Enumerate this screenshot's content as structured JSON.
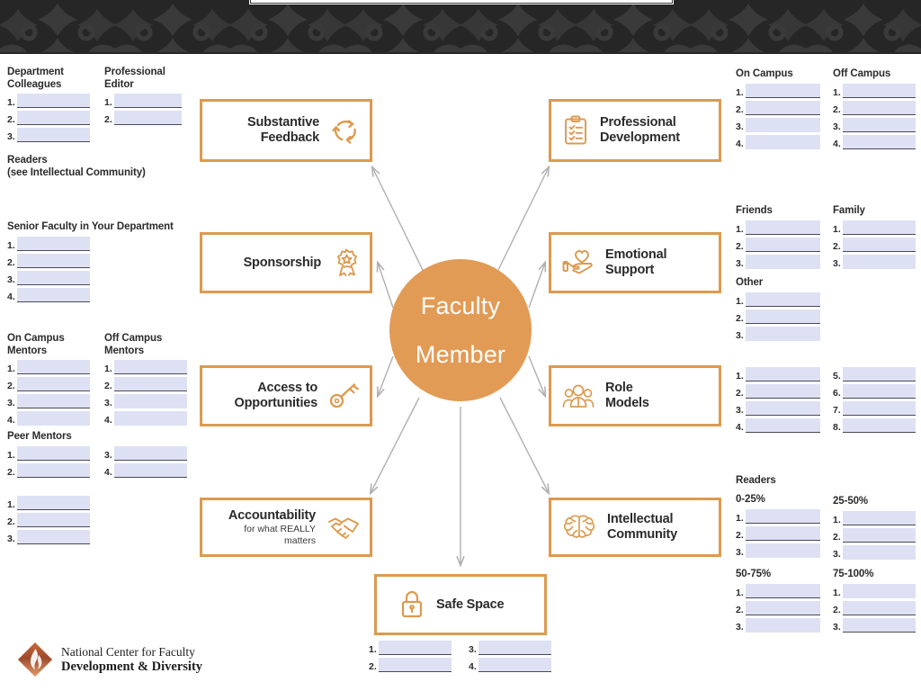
{
  "theme": {
    "accent": "#dd9a4f",
    "hub_fill": "#e29b55",
    "field_fill": "#dee1f3",
    "field_underline": "#4a4a52",
    "banner_bg": "#262626",
    "arrow": "#b0b0b0",
    "text": "#2b2b2b"
  },
  "hub": {
    "line1": "Faculty",
    "line2": "Member"
  },
  "nodes": {
    "substantive_feedback": {
      "label": "Substantive\nFeedback",
      "icon": "recycle-arrows-icon"
    },
    "sponsorship": {
      "label": "Sponsorship",
      "icon": "award-ribbon-icon"
    },
    "access": {
      "label": "Access to\nOpportunities",
      "icon": "key-icon"
    },
    "accountability": {
      "label": "Accountability",
      "sub": "for what REALLY\nmatters",
      "icon": "handshake-icon"
    },
    "safe_space": {
      "label": "Safe Space",
      "icon": "padlock-icon"
    },
    "professional_development": {
      "label": "Professional\nDevelopment",
      "icon": "clipboard-checklist-icon"
    },
    "emotional_support": {
      "label": "Emotional\nSupport",
      "icon": "hand-heart-icon"
    },
    "role_models": {
      "label": "Role\nModels",
      "icon": "people-group-icon"
    },
    "intellectual_community": {
      "label": "Intellectual\nCommunity",
      "icon": "brain-icon"
    }
  },
  "left": {
    "department_colleagues": {
      "heading": "Department\nColleagues",
      "items": [
        "1.",
        "2.",
        "3."
      ]
    },
    "professional_editor": {
      "heading": "Professional\nEditor",
      "items": [
        "1.",
        "2."
      ]
    },
    "readers_note": {
      "heading": "Readers\n(see Intellectual Community)"
    },
    "senior_faculty": {
      "heading": "Senior Faculty in Your Department",
      "items": [
        "1.",
        "2.",
        "3.",
        "4."
      ]
    },
    "on_campus_mentors": {
      "heading": "On Campus\nMentors",
      "items": [
        "1.",
        "2.",
        "3.",
        "4."
      ]
    },
    "off_campus_mentors": {
      "heading": "Off Campus\nMentors",
      "items": [
        "1.",
        "2.",
        "3.",
        "4."
      ]
    },
    "peer_mentors": {
      "heading": "Peer Mentors",
      "items_left": [
        "1.",
        "2."
      ],
      "items_right": [
        "3.",
        "4."
      ]
    },
    "accountability_list": {
      "heading": "",
      "items": [
        "1.",
        "2.",
        "3."
      ]
    }
  },
  "right": {
    "on_campus": {
      "heading": "On Campus",
      "items": [
        "1.",
        "2.",
        "3.",
        "4."
      ]
    },
    "off_campus": {
      "heading": "Off Campus",
      "items": [
        "1.",
        "2.",
        "3.",
        "4."
      ]
    },
    "friends": {
      "heading": "Friends",
      "items": [
        "1.",
        "2.",
        "3."
      ]
    },
    "family": {
      "heading": "Family",
      "items": [
        "1.",
        "2.",
        "3."
      ]
    },
    "other": {
      "heading": "Other",
      "items": [
        "1.",
        "2.",
        "3."
      ]
    },
    "role_models_list": {
      "heading": "",
      "items_left": [
        "1.",
        "2.",
        "3.",
        "4."
      ],
      "items_right": [
        "5.",
        "6.",
        "7.",
        "8."
      ]
    },
    "readers": {
      "heading": "Readers",
      "buckets": [
        {
          "heading": "0-25%",
          "items": [
            "1.",
            "2.",
            "3."
          ]
        },
        {
          "heading": "25-50%",
          "items": [
            "1.",
            "2.",
            "3."
          ]
        },
        {
          "heading": "50-75%",
          "items": [
            "1.",
            "2.",
            "3."
          ]
        },
        {
          "heading": "75-100%",
          "items": [
            "1.",
            "2.",
            "3."
          ]
        }
      ]
    }
  },
  "bottom_center": {
    "safe_space_list": {
      "items_left": [
        "1.",
        "2."
      ],
      "items_right": [
        "3.",
        "4."
      ]
    }
  },
  "logo": {
    "line1": "National Center for Faculty",
    "line2": "Development & Diversity",
    "mark": "flame-diamond-icon"
  }
}
